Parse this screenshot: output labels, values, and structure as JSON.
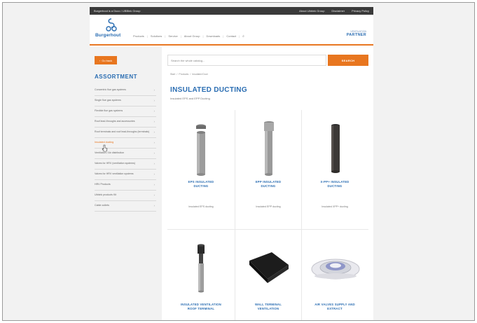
{
  "topbar": {
    "tagline": "Burgerhout is a Duco / UBBink Group",
    "links": [
      "About Ubbink Group",
      "Disclaimer",
      "Privacy Policy"
    ]
  },
  "header": {
    "brand": "Burgerhout",
    "nav": [
      "Products",
      "Solutions",
      "Service",
      "About Group",
      "Downloads",
      "Contact"
    ],
    "partner_small": "VENTILATION",
    "partner_big": "PARTNER"
  },
  "sidebar": {
    "back_label": "Go back",
    "title": "ASSORTMENT",
    "items": [
      {
        "label": "Concentric flue gas systems",
        "active": false
      },
      {
        "label": "Single flue gas systems",
        "active": false
      },
      {
        "label": "Flexible flue gas systems",
        "active": false
      },
      {
        "label": "Roof lead-throughs and accessories",
        "active": false
      },
      {
        "label": "Roof terminals and roof lead-throughs (terminals)",
        "active": false
      },
      {
        "label": "Insulated ducting",
        "active": true
      },
      {
        "label": "Ventilation / Air distribution",
        "active": false
      },
      {
        "label": "Valves for HRV (ventilation systems)",
        "active": false
      },
      {
        "label": "Valves for HRV ventilation systems",
        "active": false
      },
      {
        "label": "HRV Products",
        "active": false
      },
      {
        "label": "Ubbink products Kit",
        "active": false
      },
      {
        "label": "Cable outlets",
        "active": false
      }
    ]
  },
  "search": {
    "placeholder": "Search the whole catalog...",
    "button": "SEARCH"
  },
  "breadcrumb": [
    "Start",
    "Products",
    "Insulated Duct"
  ],
  "page": {
    "title": "INSULATED DUCTING",
    "subtitle": "Insulated EPS and EPP Ducting"
  },
  "products": [
    {
      "name_line1": "EPS INSULATED",
      "name_line2": "DUCTING",
      "desc": "Insulated EPS ducting",
      "icon": "grey-duct"
    },
    {
      "name_line1": "EPP INSULATED",
      "name_line2": "DUCTING",
      "desc": "Insulated EPP ducting",
      "icon": "grey-duct-socket"
    },
    {
      "name_line1": "X-PP+ INSULATED",
      "name_line2": "DUCTING",
      "desc": "Insulated XPP+ ducting",
      "icon": "black-duct"
    },
    {
      "name_line1": "INSULATED VENTILATION",
      "name_line2": "ROOF TERMINAL",
      "desc": "",
      "icon": "roof-terminal"
    },
    {
      "name_line1": "WALL TERMINAL",
      "name_line2": "VENTILATION",
      "desc": "",
      "icon": "wall-terminal"
    },
    {
      "name_line1": "AIR VALVES SUPPLY AND",
      "name_line2": "EXTRACT",
      "desc": "",
      "icon": "air-valve"
    }
  ],
  "colors": {
    "accent": "#e8761f",
    "brand": "#2a6db2",
    "topbar": "#3a3a3a"
  }
}
